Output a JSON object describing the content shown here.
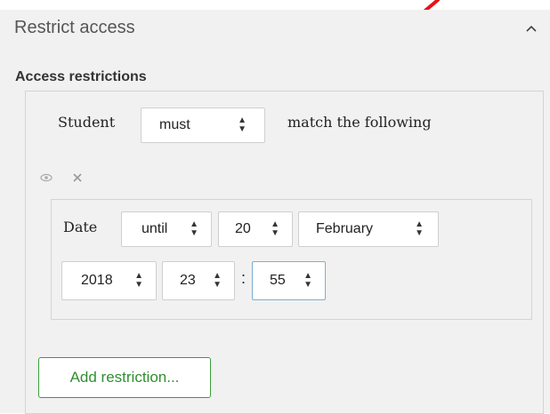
{
  "panel": {
    "title": "Restrict access",
    "collapse_icon": "chevron-up-icon"
  },
  "restrictions": {
    "label": "Access restrictions",
    "student_label": "Student",
    "must_select": "must",
    "match_text": "match the following",
    "eye_icon": "eye-icon",
    "delete_icon": "close-icon",
    "condition": {
      "type_label": "Date",
      "direction": "until",
      "day": "20",
      "month": "February",
      "year": "2018",
      "hour": "23",
      "separator": ":",
      "minute": "55"
    },
    "add_button": "Add restriction..."
  },
  "colors": {
    "panel_bg": "#f1f1f1",
    "green": "#3a9d3a",
    "active_border": "#7eaecf",
    "annotation_red": "#e8101a"
  }
}
